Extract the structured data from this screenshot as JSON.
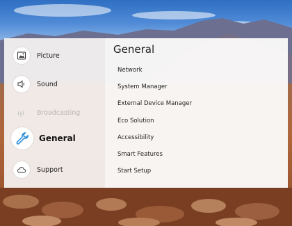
{
  "sidebar": {
    "items": [
      {
        "label": "Picture",
        "icon": "picture-icon",
        "state": "normal"
      },
      {
        "label": "Sound",
        "icon": "speaker-icon",
        "state": "normal"
      },
      {
        "label": "Broadcasting",
        "icon": "antenna-icon",
        "state": "disabled"
      },
      {
        "label": "General",
        "icon": "wrench-icon",
        "state": "selected"
      },
      {
        "label": "Support",
        "icon": "cloud-icon",
        "state": "normal"
      }
    ]
  },
  "main": {
    "title": "General",
    "items": [
      "Network",
      "System Manager",
      "External Device Manager",
      "Eco Solution",
      "Accessibility",
      "Smart Features",
      "Start Setup"
    ]
  },
  "colors": {
    "selected_icon": "#2a8fd6",
    "text": "#222222",
    "disabled_text": "#b7b5b4"
  }
}
